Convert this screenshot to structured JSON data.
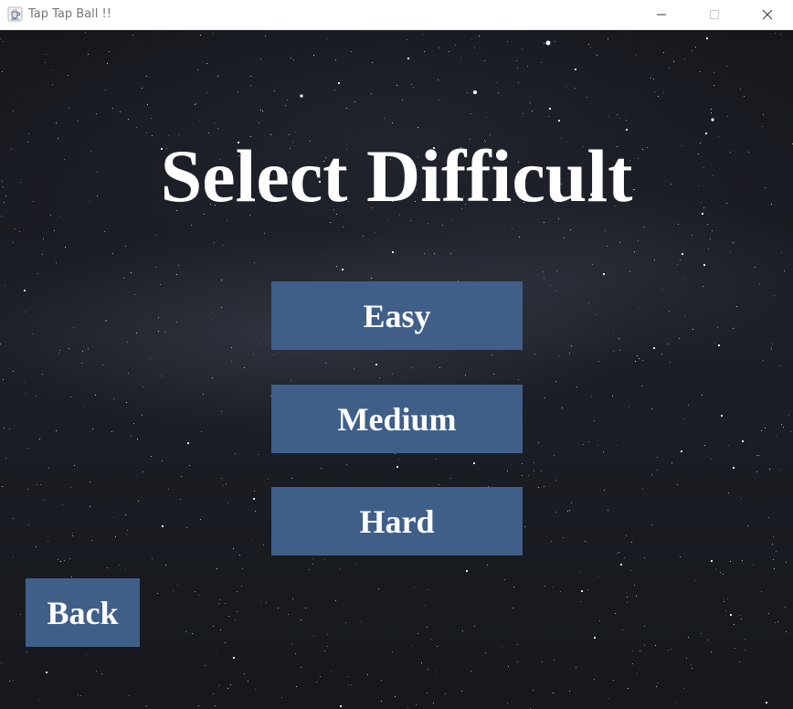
{
  "window": {
    "title": "Tap Tap Ball !!",
    "app_icon": "java-coffee-cup-icon",
    "controls": [
      "minimize-icon",
      "maximize-icon",
      "close-icon"
    ]
  },
  "screen": {
    "heading": "Select Difficult",
    "background": "starry-night-sky",
    "accent_color": "#3f5f88",
    "text_color": "#ffffff"
  },
  "difficulty_options": [
    {
      "label": "Easy"
    },
    {
      "label": "Medium"
    },
    {
      "label": "Hard"
    }
  ],
  "navigation": {
    "back_label": "Back"
  }
}
